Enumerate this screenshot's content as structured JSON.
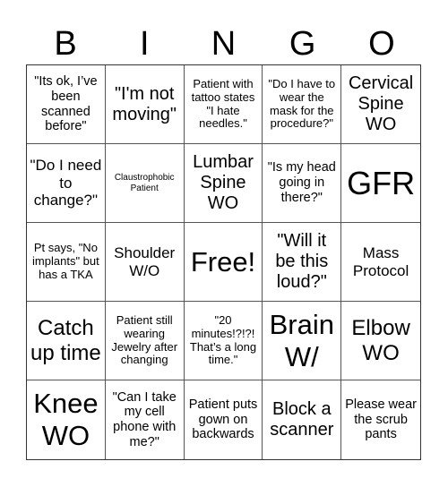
{
  "header": {
    "letters": [
      "B",
      "I",
      "N",
      "G",
      "O"
    ]
  },
  "cells": [
    {
      "text": "\"Its ok, I’ve been scanned before\"",
      "size": "s3"
    },
    {
      "text": "\"I'm not moving\"",
      "size": "s5"
    },
    {
      "text": "Patient with tattoo states \"I hate needles.\"",
      "size": "s2"
    },
    {
      "text": "\"Do I have to wear the mask for the procedure?\"",
      "size": "s2"
    },
    {
      "text": "Cervical Spine WO",
      "size": "s5"
    },
    {
      "text": "\"Do I need to change?\"",
      "size": "s4"
    },
    {
      "text": "Claustrophobic Patient",
      "size": "s1"
    },
    {
      "text": "Lumbar Spine WO",
      "size": "s5"
    },
    {
      "text": "\"Is my head going in there?\"",
      "size": "s3"
    },
    {
      "text": "GFR",
      "size": "s8"
    },
    {
      "text": "Pt says, \"No implants\" but has a TKA",
      "size": "s2"
    },
    {
      "text": "Shoulder W/O",
      "size": "s4"
    },
    {
      "text": "Free!",
      "size": "s7"
    },
    {
      "text": "\"Will it be this loud?\"",
      "size": "s5"
    },
    {
      "text": "Mass Protocol",
      "size": "s4"
    },
    {
      "text": "Catch up time",
      "size": "s6"
    },
    {
      "text": "Patient still wearing Jewelry after changing",
      "size": "s2"
    },
    {
      "text": "\"20 minutes!?!?! That’s a long time.\"",
      "size": "s2"
    },
    {
      "text": "Brain W/",
      "size": "s7"
    },
    {
      "text": "Elbow WO",
      "size": "s6"
    },
    {
      "text": "Knee WO",
      "size": "s7"
    },
    {
      "text": "\"Can I take my cell phone with me?\"",
      "size": "s3"
    },
    {
      "text": "Patient puts gown on backwards",
      "size": "s3"
    },
    {
      "text": "Block a scanner",
      "size": "s5"
    },
    {
      "text": "Please wear the scrub pants",
      "size": "s3"
    }
  ]
}
